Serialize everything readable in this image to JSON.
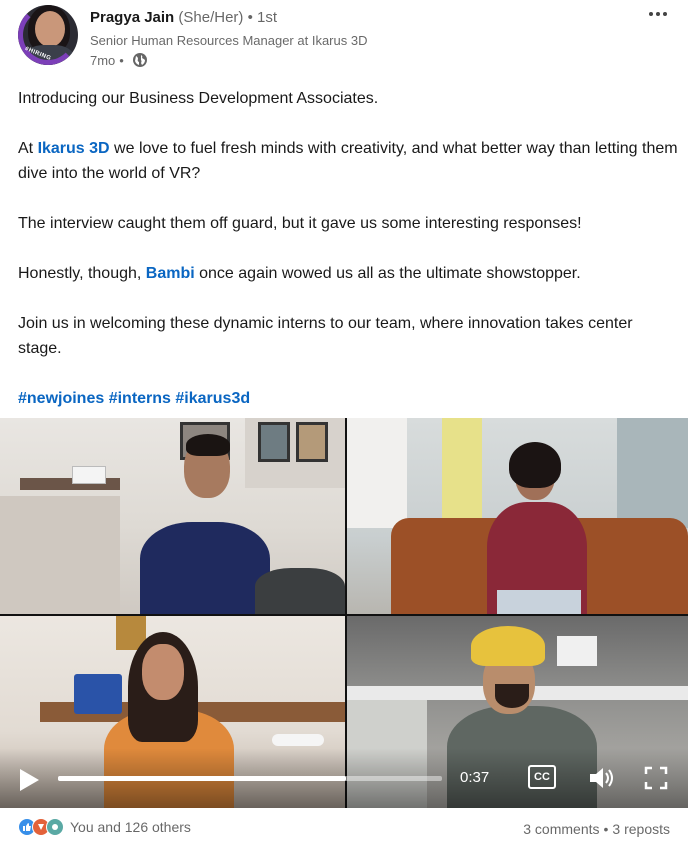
{
  "author": {
    "name": "Pragya Jain",
    "pronouns": "(She/Her)",
    "degree": "• 1st",
    "headline": "Senior Human Resources Manager at Ikarus 3D",
    "time_ago": "7mo",
    "visibility_sep": "•",
    "visibility_icon": "globe-icon",
    "avatar_badge": "#HIRING"
  },
  "post": {
    "p1": "Introducing our Business Development Associates.",
    "p2_before": "At ",
    "p2_link": "Ikarus 3D",
    "p2_after": " we love to fuel fresh minds with creativity, and what better way than letting them dive into the world of VR?",
    "p3": "The interview caught them off guard, but it gave us some interesting responses!",
    "p4_before": "Honestly, though, ",
    "p4_link": "Bambi",
    "p4_after": " once again wowed us all as the ultimate showstopper.",
    "p5": "Join us in welcoming these dynamic interns to our team, where innovation takes center stage.",
    "hashtags": [
      "#newjoines",
      "#interns",
      "#ikarus3d"
    ]
  },
  "video": {
    "time": "0:37",
    "cc_label": "CC",
    "progress": 0.75
  },
  "social": {
    "reaction_text": "You and 126 others",
    "comments": "3 comments",
    "sep": "•",
    "reposts": "3 reposts"
  },
  "colors": {
    "link": "#0a66c2",
    "like": "#378fe9",
    "celebrate": "#e3623a",
    "support": "#5aa9a4"
  }
}
